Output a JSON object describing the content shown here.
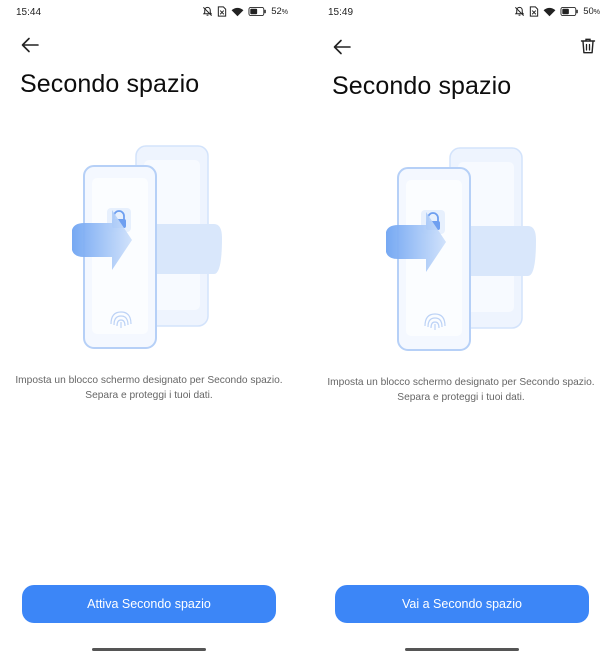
{
  "screens": [
    {
      "status": {
        "time": "15:44",
        "battery": "52",
        "battery_unit": "%"
      },
      "title": "Secondo spazio",
      "description": {
        "line1": "Imposta un blocco schermo designato per Secondo spazio.",
        "line2": "Separa e proteggi i tuoi dati."
      },
      "primary_button": "Attiva Secondo spazio",
      "has_trash_icon": false
    },
    {
      "status": {
        "time": "15:49",
        "battery": "50",
        "battery_unit": "%"
      },
      "title": "Secondo spazio",
      "description": {
        "line1": "Imposta un blocco schermo designato per Secondo spazio.",
        "line2": "Separa e proteggi i tuoi dati."
      },
      "primary_button": "Vai a Secondo spazio",
      "has_trash_icon": true
    }
  ],
  "icons": {
    "status": [
      "silent-icon",
      "no-sim-icon",
      "wifi-icon",
      "battery-icon"
    ],
    "navigation": "back-arrow-icon",
    "action": "trash-icon",
    "illustration": [
      "phone-icon",
      "lock-icon",
      "arrow-right-icon",
      "fingerprint-icon"
    ]
  },
  "colors": {
    "accent": "#3c86f7",
    "button_text": "#ffffff",
    "illustration_blue": "#8fb8f7",
    "text_secondary": "#666666"
  }
}
